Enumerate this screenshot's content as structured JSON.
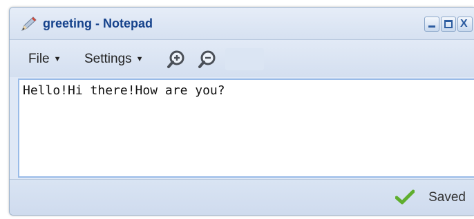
{
  "window": {
    "title": "greeting - Notepad",
    "app_icon": "pencil-icon",
    "controls": [
      "minimize-icon",
      "maximize-icon",
      "close-icon"
    ],
    "close_glyph": "X"
  },
  "toolbar": {
    "file_label": "File",
    "settings_label": "Settings",
    "zoom_in_icon": "zoom-in-icon",
    "zoom_out_icon": "zoom-out-icon"
  },
  "editor": {
    "content": "Hello!Hi there!How are you?"
  },
  "status": {
    "icon": "checkmark-icon",
    "text": "Saved"
  },
  "colors": {
    "title_text": "#15428b",
    "window_bg": "#dfe8f6",
    "editor_border": "#99bbe8",
    "check_green": "#5fae2e"
  }
}
